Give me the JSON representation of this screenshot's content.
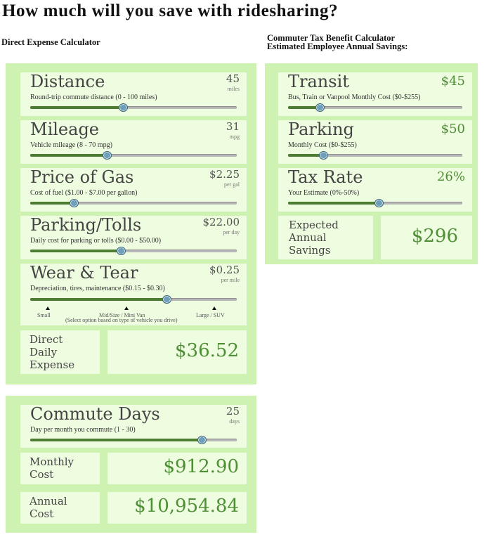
{
  "title": "How much will you save with ridesharing?",
  "direct": {
    "heading": "Direct Expense Calculator",
    "sliders": [
      {
        "label": "Distance",
        "value": "45",
        "unit": "miles",
        "desc": "Round-trip commute distance (0 - 100 miles)",
        "position": 0.45
      },
      {
        "label": "Mileage",
        "value": "31",
        "unit": "mpg",
        "desc": "Vehicle mileage (8 - 70 mpg)",
        "position": 0.37
      },
      {
        "label": "Price of Gas",
        "value": "$2.25",
        "unit": "per gal",
        "desc": "Cost of fuel ($1.00 - $7.00 per gallon)",
        "position": 0.21
      },
      {
        "label": "Parking/Tolls",
        "value": "$22.00",
        "unit": "per day",
        "desc": "Daily cost for parking or tolls ($0.00 - $50.00)",
        "position": 0.44
      },
      {
        "label": "Wear & Tear",
        "value": "$0.25",
        "unit": "per mile",
        "desc": "Depreciation, tires, maintenance ($0.15 - $0.30)",
        "position": 0.66
      }
    ],
    "vehicle_marks": [
      "Small",
      "Mid/Size / Mini Van",
      "Large / SUV"
    ],
    "vehicle_hint": "(Select option based on type of vehicle you drive)",
    "result_label": "Direct\nDaily\nExpense",
    "result_value": "$36.52"
  },
  "commute": {
    "label": "Commute Days",
    "value": "25",
    "unit": "days",
    "desc": "Day per month you commute (1 - 30)",
    "position": 0.83,
    "monthly_label": "Monthly\nCost",
    "monthly_value": "$912.90",
    "annual_label": "Annual\nCost",
    "annual_value": "$10,954.84"
  },
  "tax": {
    "heading_line1": "Commuter Tax Benefit Calculator",
    "heading_line2": "Estimated Employee Annual Savings:",
    "sliders": [
      {
        "label": "Transit",
        "value": "$45",
        "desc": "Bus, Train or Vanpool Monthly Cost ($0-$255)",
        "position": 0.18
      },
      {
        "label": "Parking",
        "value": "$50",
        "desc": "Monthly Cost ($0-$255)",
        "position": 0.2
      },
      {
        "label": "Tax Rate",
        "value": "26%",
        "desc": "Your Estimate (0%-50%)",
        "position": 0.52
      }
    ],
    "result_label": "Expected\nAnnual\nSavings",
    "result_value": "$296"
  },
  "colors": {
    "panel": "#cdf2b2",
    "card": "#eefce0",
    "accent": "#4e8f35",
    "slider_fill": "#4d7d33"
  }
}
